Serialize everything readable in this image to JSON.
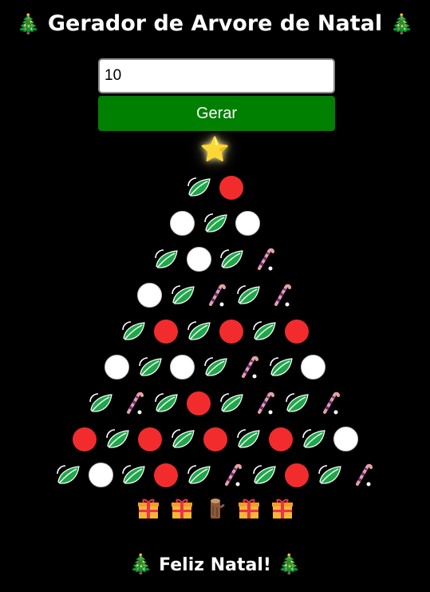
{
  "header": {
    "tree_emoji": "🎄",
    "title": "Gerador de Arvore de Natal"
  },
  "form": {
    "input_value": "10",
    "button_label": "Gerar"
  },
  "tree": {
    "star": "⭐",
    "rows": [
      [
        "leaf",
        "red"
      ],
      [
        "white",
        "leaf",
        "white"
      ],
      [
        "leaf",
        "white",
        "leaf",
        "cane"
      ],
      [
        "white",
        "leaf",
        "cane",
        "leaf",
        "cane"
      ],
      [
        "leaf",
        "red",
        "leaf",
        "red",
        "leaf",
        "red"
      ],
      [
        "white",
        "leaf",
        "white",
        "leaf",
        "cane",
        "leaf",
        "white"
      ],
      [
        "leaf",
        "cane",
        "leaf",
        "red",
        "leaf",
        "cane",
        "leaf",
        "cane"
      ],
      [
        "red",
        "leaf",
        "red",
        "leaf",
        "red",
        "leaf",
        "red",
        "leaf",
        "white"
      ],
      [
        "leaf",
        "white",
        "leaf",
        "red",
        "leaf",
        "cane",
        "leaf",
        "red",
        "leaf",
        "cane"
      ]
    ],
    "base": [
      "gift",
      "gift",
      "log",
      "gift",
      "gift"
    ]
  },
  "footer": {
    "tree_emoji": "🎄",
    "text": "Feliz Natal!"
  },
  "colors": {
    "background": "#000000",
    "button": "#008000",
    "red_ball": "#f22c2c",
    "white_ball": "#ffffff",
    "leaf": "#1fa74a"
  }
}
